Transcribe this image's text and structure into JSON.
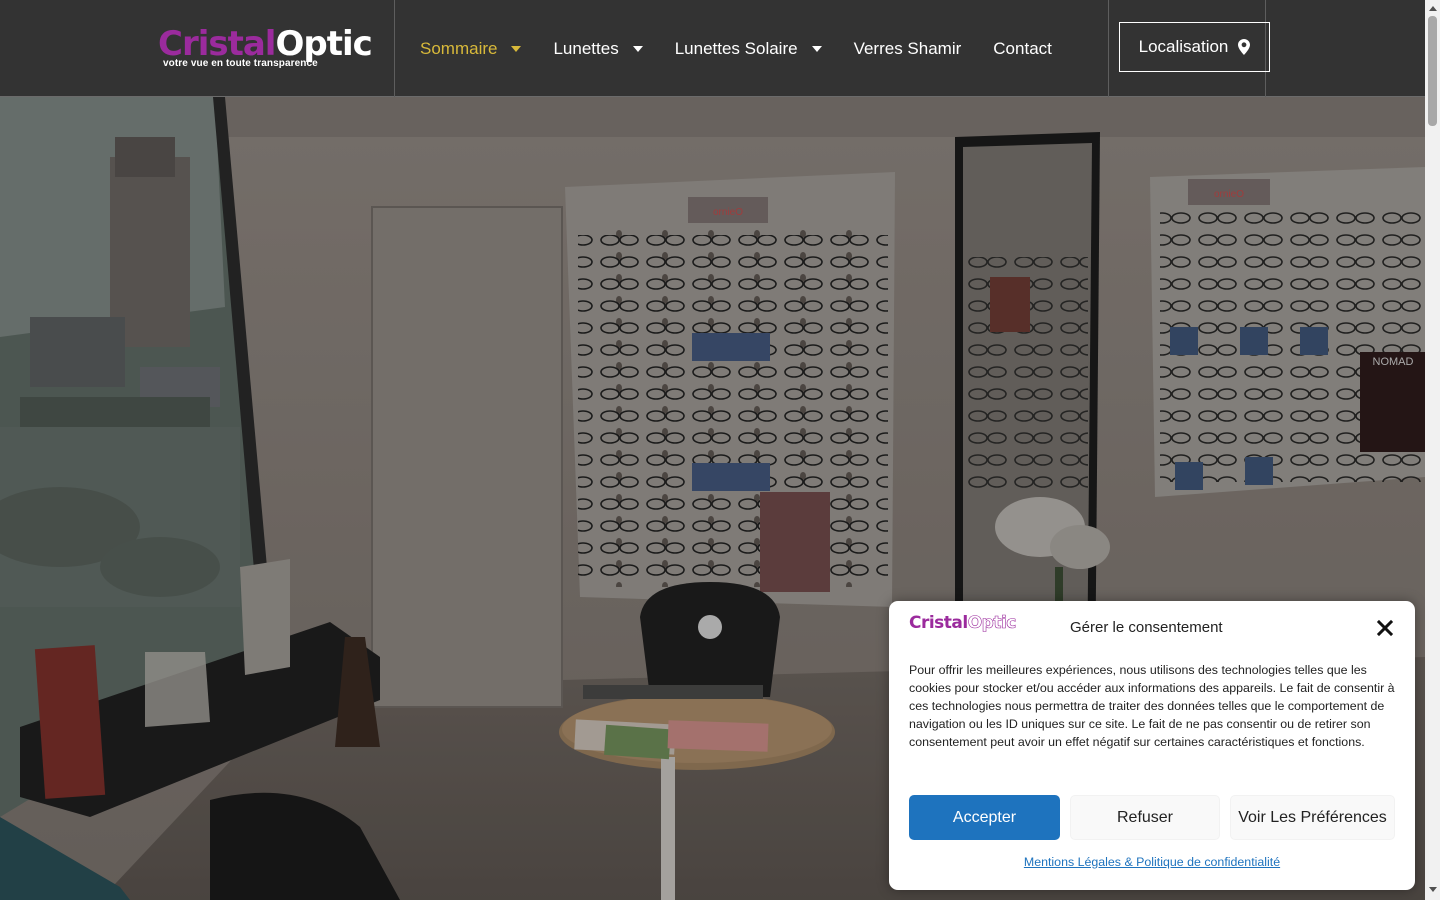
{
  "header": {
    "logo": {
      "part1": "Cristal",
      "part2": "Optic",
      "tagline": "votre vue en toute transparence"
    },
    "nav": [
      {
        "label": "Sommaire",
        "active": true,
        "dropdown": true
      },
      {
        "label": "Lunettes",
        "active": false,
        "dropdown": true
      },
      {
        "label": "Lunettes Solaire",
        "active": false,
        "dropdown": true
      },
      {
        "label": "Verres Shamir",
        "active": false,
        "dropdown": false
      },
      {
        "label": "Contact",
        "active": false,
        "dropdown": false
      }
    ],
    "location_button": "Localisation"
  },
  "hero": {
    "brand_sign_1": "ornieO",
    "brand_sign_2": "ornieO",
    "poster_label": "NOMAD"
  },
  "consent": {
    "logo": {
      "part1": "Cristal",
      "part2": "Optic"
    },
    "title": "Gérer le consentement",
    "text": "Pour offrir les meilleures expériences, nous utilisons des technologies telles que les cookies pour stocker et/ou accéder aux informations des appareils. Le fait de consentir à ces technologies nous permettra de traiter des données telles que le comportement de navigation ou les ID uniques sur ce site. Le fait de ne pas consentir ou de retirer son consentement peut avoir un effet négatif sur certaines caractéristiques et fonctions.",
    "accept": "Accepter",
    "refuse": "Refuser",
    "preferences": "Voir Les Préférences",
    "legal_link": "Mentions Légales & Politique de confidentialité"
  },
  "colors": {
    "header_bg": "#333333",
    "accent_gold": "#d8b93a",
    "brand_purple": "#9b2b9d",
    "accept_blue": "#1e73be"
  },
  "icons": [
    "chevron-down-icon",
    "map-pin-icon",
    "close-icon"
  ]
}
